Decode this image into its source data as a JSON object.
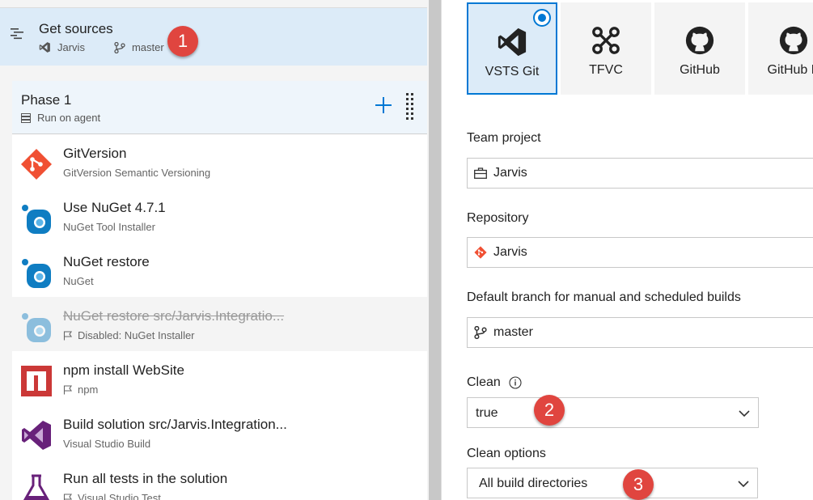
{
  "get_sources": {
    "title": "Get sources",
    "repo": "Jarvis",
    "branch": "master",
    "badge": "1"
  },
  "phase": {
    "title": "Phase 1",
    "subtitle": "Run on agent"
  },
  "tasks": [
    {
      "title": "GitVersion",
      "subtitle": "GitVersion Semantic Versioning",
      "icon": "git-diamond-icon",
      "disabled": false,
      "flag": false
    },
    {
      "title": "Use NuGet 4.7.1",
      "subtitle": "NuGet Tool Installer",
      "icon": "nuget-icon",
      "disabled": false,
      "flag": false
    },
    {
      "title": "NuGet restore",
      "subtitle": "NuGet",
      "icon": "nuget-icon",
      "disabled": false,
      "flag": false
    },
    {
      "title": "NuGet restore src/Jarvis.Integratio...",
      "subtitle": "Disabled: NuGet Installer",
      "icon": "nuget-icon",
      "disabled": true,
      "flag": true
    },
    {
      "title": "npm install WebSite",
      "subtitle": "npm",
      "icon": "npm-icon",
      "disabled": false,
      "flag": true
    },
    {
      "title": "Build solution src/Jarvis.Integration...",
      "subtitle": "Visual Studio Build",
      "icon": "visual-studio-icon",
      "disabled": false,
      "flag": false
    },
    {
      "title": "Run all tests in the solution",
      "subtitle": "Visual Studio Test",
      "icon": "flask-icon",
      "disabled": false,
      "flag": true
    }
  ],
  "sources": [
    {
      "label": "VSTS Git",
      "icon": "vsts-icon",
      "selected": true
    },
    {
      "label": "TFVC",
      "icon": "tfvc-icon",
      "selected": false
    },
    {
      "label": "GitHub",
      "icon": "github-icon",
      "selected": false
    },
    {
      "label": "GitHub E",
      "icon": "github-icon",
      "selected": false
    }
  ],
  "form": {
    "team_project_label": "Team project",
    "team_project_value": "Jarvis",
    "repository_label": "Repository",
    "repository_value": "Jarvis",
    "branch_label": "Default branch for manual and scheduled builds",
    "branch_value": "master",
    "clean_label": "Clean",
    "clean_value": "true",
    "clean_badge": "2",
    "clean_options_label": "Clean options",
    "clean_options_value": "All build directories",
    "clean_options_badge": "3"
  },
  "colors": {
    "accent": "#0078d4",
    "selected_bg": "#dcebf8",
    "badge": "#e0453f",
    "git_orange": "#f05033",
    "npm_red": "#cb3837",
    "vs_purple": "#68217a"
  }
}
